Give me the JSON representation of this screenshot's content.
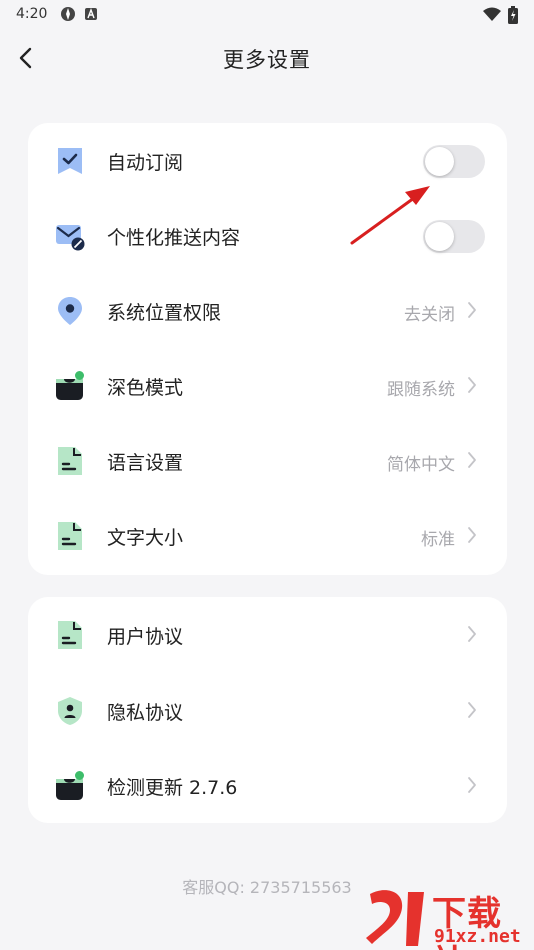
{
  "status_bar": {
    "time": "4:20"
  },
  "header": {
    "title": "更多设置"
  },
  "settings_group1": [
    {
      "name": "auto-subscribe",
      "label": "自动订阅",
      "type": "toggle",
      "on": false
    },
    {
      "name": "personalized-push",
      "label": "个性化推送内容",
      "type": "toggle",
      "on": false
    },
    {
      "name": "location-permission",
      "label": "系统位置权限",
      "value": "去关闭"
    },
    {
      "name": "dark-mode",
      "label": "深色模式",
      "value": "跟随系统"
    },
    {
      "name": "language",
      "label": "语言设置",
      "value": "简体中文"
    },
    {
      "name": "font-size",
      "label": "文字大小",
      "value": "标准"
    }
  ],
  "settings_group2": [
    {
      "name": "user-agreement",
      "label": "用户协议"
    },
    {
      "name": "privacy-policy",
      "label": "隐私协议"
    },
    {
      "name": "check-update",
      "label": "检测更新 2.7.6"
    }
  ],
  "footer": {
    "customer_service": "客服QQ: 2735715563"
  },
  "watermark": {
    "title": "下载站",
    "domain": "91xz.net"
  },
  "colors": {
    "accent_blue": "#5a8ef0",
    "icon_green": "#3dbd6a",
    "annotation_red": "#d81f1f"
  }
}
